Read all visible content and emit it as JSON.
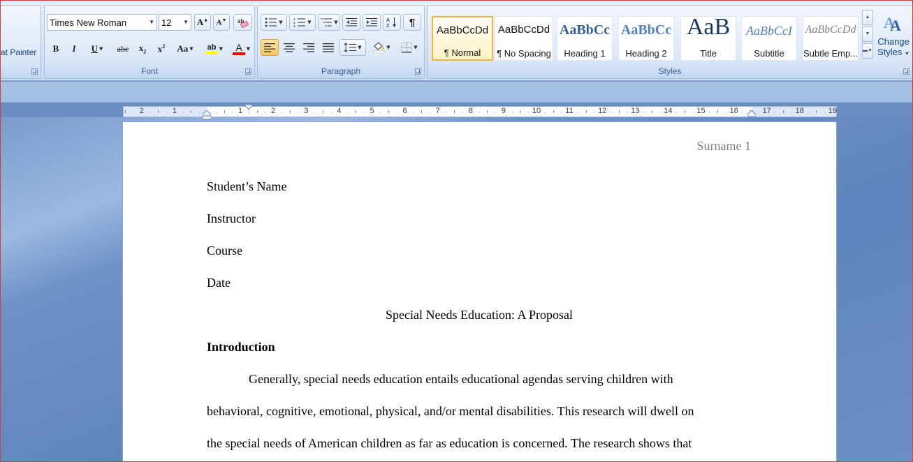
{
  "clipboard": {
    "format_painter": "at Painter"
  },
  "font": {
    "label": "Font",
    "name": "Times New Roman",
    "size": "12",
    "grow_glyph": "A",
    "shrink_glyph": "A",
    "bold": "B",
    "italic": "I",
    "underline": "U",
    "strike": "abe",
    "subscript": "x",
    "superscript": "x",
    "change_case": "Aa",
    "highlight_text": "ab",
    "color_text": "A",
    "highlight_color": "#ffff00",
    "font_color": "#ff0000"
  },
  "paragraph": {
    "label": "Paragraph",
    "pilcrow": "¶"
  },
  "styles": {
    "label": "Styles",
    "items": [
      {
        "sample": "AaBbCcDd",
        "name": "¶ Normal"
      },
      {
        "sample": "AaBbCcDd",
        "name": "¶ No Spacing"
      },
      {
        "sample": "AaBbCc",
        "name": "Heading 1"
      },
      {
        "sample": "AaBbCc",
        "name": "Heading 2"
      },
      {
        "sample": "AaB",
        "name": "Title"
      },
      {
        "sample": "AaBbCcI",
        "name": "Subtitle"
      },
      {
        "sample": "AaBbCcDd",
        "name": "Subtle Emp..."
      }
    ],
    "change_styles_line1": "Change",
    "change_styles_line2": "Styles"
  },
  "ruler": {
    "left_numbers": [
      "2",
      "1"
    ],
    "numbers": [
      "1",
      "2",
      "3",
      "4",
      "5",
      "6",
      "7",
      "8",
      "9",
      "10",
      "11",
      "12",
      "13",
      "14",
      "15",
      "16",
      "17",
      "18",
      "19"
    ]
  },
  "document": {
    "header": "Surname 1",
    "student": "Student’s Name",
    "instructor": "Instructor",
    "course": "Course",
    "date": "Date",
    "title": "Special Needs Education: A Proposal",
    "heading": "Introduction",
    "line1": "Generally, special needs education entails educational agendas serving children with",
    "line2": "behavioral, cognitive, emotional, physical, and/or mental disabilities. This research will dwell on",
    "line3": "the special needs of American children as far as education is concerned. The research shows that"
  }
}
